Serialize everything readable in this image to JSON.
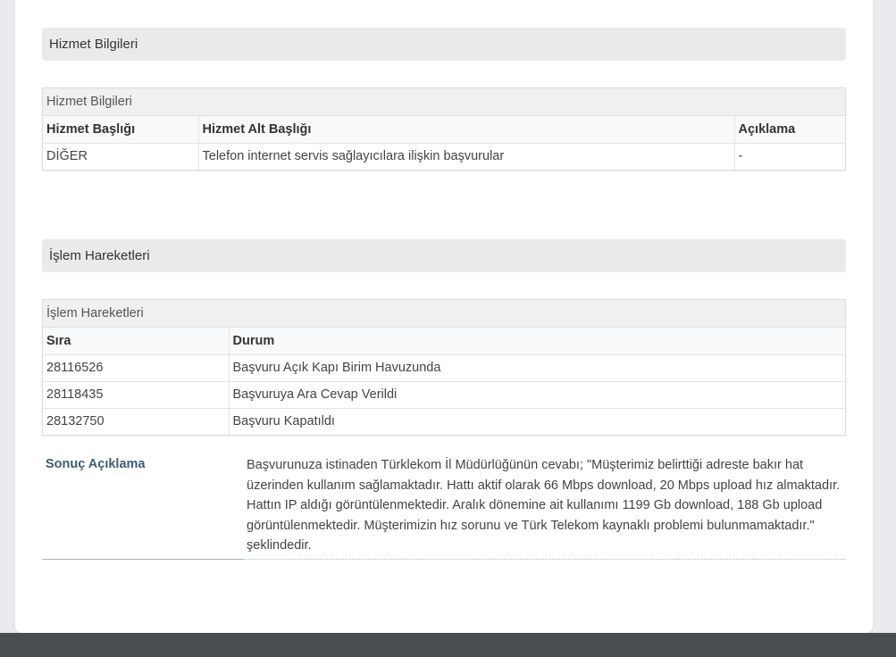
{
  "service_section": {
    "header": "Hizmet Bilgileri",
    "caption": "Hizmet Bilgileri",
    "columns": [
      "Hizmet Başlığı",
      "Hizmet Alt Başlığı",
      "Açıklama"
    ],
    "rows": [
      [
        "DİĞER",
        "Telefon internet servis sağlayıcılara ilişkin başvurular",
        "-"
      ]
    ]
  },
  "transactions_section": {
    "header": "İşlem Hareketleri",
    "caption": "İşlem Hareketleri",
    "columns": [
      "Sıra",
      "Durum"
    ],
    "rows": [
      [
        "28116526",
        "Başvuru Açık Kapı Birim Havuzunda"
      ],
      [
        "28118435",
        "Başvuruya Ara Cevap Verildi"
      ],
      [
        "28132750",
        "Başvuru Kapatıldı"
      ]
    ]
  },
  "result": {
    "label": "Sonuç Açıklama",
    "text": "Başvurunuza istinaden Türklekom İl Müdürlüğünün cevabı; \"Müşterimiz belirttiği adreste bakır hat üzerinden kullanım sağlamaktadır. Hattı aktif olarak 66 Mbps download, 20 Mbps upload hız almaktadır. Hattın IP aldığı görüntülenmektedir. Aralık dönemine ait kullanımı 1199 Gb download, 188 Gb upload görüntülenmektedir. Müşterimizin hız sorunu ve Türk Telekom kaynaklı problemi bulunmamaktadır.\" şeklindedir."
  },
  "colors": {
    "section_header_bg": "#e8eaec",
    "result_label": "#3c5d7a",
    "footer_bar": "#4a4d50"
  }
}
